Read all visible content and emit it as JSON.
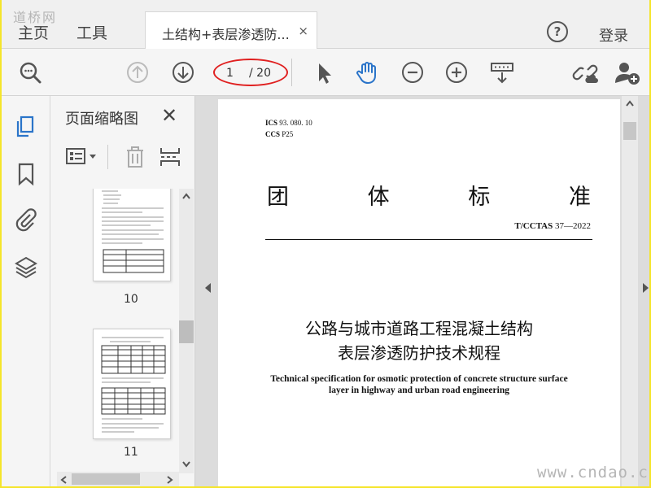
{
  "watermarks": {
    "top": "道桥网",
    "bottom": "www.cndao.com"
  },
  "tabs": {
    "home": "主页",
    "tools": "工具",
    "document": "土结构+表层渗透防...",
    "close": "×"
  },
  "header": {
    "help": "?",
    "login": "登录"
  },
  "navigation": {
    "current_page": "1",
    "total_pages": "/ 20"
  },
  "thumbnail_panel": {
    "title": "页面缩略图",
    "close": "✕",
    "thumbnails": [
      {
        "page": "10"
      },
      {
        "page": "11"
      }
    ]
  },
  "document": {
    "ics_label": "ICS",
    "ics_value": "93. 080. 10",
    "ccs_label": "CCS",
    "ccs_value": "P25",
    "standard_type": [
      "团",
      "体",
      "标",
      "准"
    ],
    "standard_prefix": "T/CCTAS",
    "standard_number": "37—2022",
    "title_cn_line1": "公路与城市道路工程混凝土结构",
    "title_cn_line2": "表层渗透防护技术规程",
    "title_en_line1": "Technical specification for osmotic protection of concrete structure surface",
    "title_en_line2": "layer in highway and urban road engineering"
  },
  "colors": {
    "accent": "#2a74c9",
    "highlight": "#e02020",
    "frame": "#f5e52a"
  }
}
